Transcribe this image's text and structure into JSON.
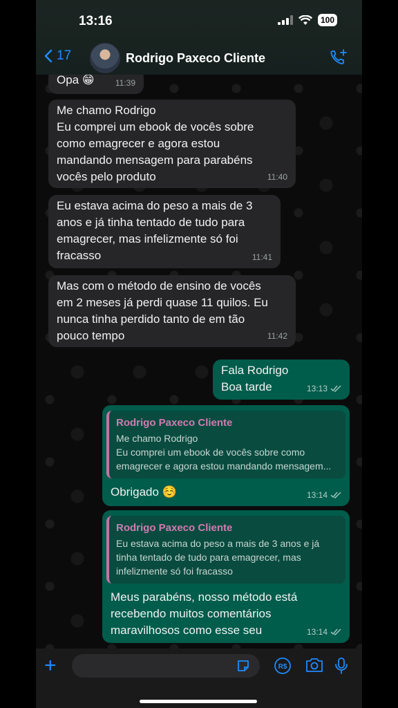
{
  "status_bar": {
    "time": "13:16",
    "battery": "100"
  },
  "header": {
    "back_count": "17",
    "contact_name": "Rodrigo Paxeco Cliente"
  },
  "messages": [
    {
      "text": "Opa 😁",
      "time": "11:39"
    },
    {
      "text": "Me chamo Rodrigo\nEu comprei um ebook de vocês sobre\ncomo emagrecer e agora estou\nmandando mensagem para parabéns\nvocês pelo produto",
      "time": "11:40"
    },
    {
      "text": "Eu estava acima do peso a mais de 3\nanos e já tinha tentado de tudo para\nemagrecer, mas infelizmente só foi\nfracasso",
      "time": "11:41"
    },
    {
      "text": "Mas com o método de ensino de vocês\nem 2 meses já perdi quase 11 quilos. Eu\nnunca tinha perdido tanto de em tão\npouco tempo",
      "time": "11:42"
    },
    {
      "text": "Fala Rodrigo\nBoa tarde",
      "time": "13:13"
    },
    {
      "quote_name": "Rodrigo Paxeco Cliente",
      "quote_text": "Me chamo Rodrigo\nEu comprei um ebook de vocês sobre como\nemagrecer e agora estou mandando mensagem...",
      "text": "Obrigado ☺️",
      "time": "13:14"
    },
    {
      "quote_name": "Rodrigo Paxeco Cliente",
      "quote_text": "Eu estava acima do peso a mais de 3 anos e já\ntinha tentado de tudo para emagrecer, mas\ninfelizmente só foi fracasso",
      "text": "Meus parabéns, nosso método está\nrecebendo muitos comentários\nmaravilhosos como esse seu",
      "time": "13:14"
    }
  ],
  "colors": {
    "accent": "#1d8cff",
    "outgoing_bubble": "#005c4b",
    "incoming_bubble": "#262628",
    "quote_name": "#d17bb0"
  },
  "composer": {
    "icons": [
      "plus-icon",
      "sticker-icon",
      "pix-icon",
      "camera-icon",
      "microphone-icon"
    ]
  }
}
